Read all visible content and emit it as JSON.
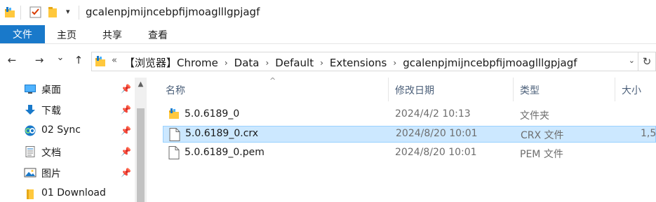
{
  "window": {
    "title": "gcalenpjmijncebpfijmoaglllgpjagf"
  },
  "ribbon": {
    "tabs": [
      {
        "label": "文件"
      },
      {
        "label": "主页"
      },
      {
        "label": "共享"
      },
      {
        "label": "查看"
      }
    ]
  },
  "nav": {
    "back_glyph": "←",
    "forward_glyph": "→",
    "recent_glyph": "⌄",
    "up_glyph": "↑",
    "overflow_glyph": "«",
    "breadcrumbs": [
      "【浏览器】Chrome",
      "Data",
      "Default",
      "Extensions",
      "gcalenpjmijncebpfijmoaglllgpjagf"
    ],
    "refresh_glyph": "↻"
  },
  "sidebar": {
    "items": [
      {
        "label": "桌面",
        "icon": "desktop-icon",
        "pinned": true
      },
      {
        "label": "下载",
        "icon": "download-icon",
        "pinned": true
      },
      {
        "label": "02 Sync",
        "icon": "sync-icon",
        "pinned": true
      },
      {
        "label": "文档",
        "icon": "document-icon",
        "pinned": true
      },
      {
        "label": "图片",
        "icon": "pictures-icon",
        "pinned": true
      },
      {
        "label": "01 Download",
        "icon": "folder-icon",
        "pinned": false
      }
    ]
  },
  "columns": {
    "name": "名称",
    "date": "修改日期",
    "type": "类型",
    "size": "大小"
  },
  "files": [
    {
      "name": "5.0.6189_0",
      "date": "2024/4/2 10:13",
      "type": "文件夹",
      "size": "",
      "icon": "folder-icon",
      "selected": false
    },
    {
      "name": "5.0.6189_0.crx",
      "date": "2024/8/20 10:01",
      "type": "CRX 文件",
      "size": "1,5",
      "icon": "file-icon",
      "selected": true
    },
    {
      "name": "5.0.6189_0.pem",
      "date": "2024/8/20 10:01",
      "type": "PEM 文件",
      "size": "",
      "icon": "file-icon",
      "selected": false
    }
  ],
  "colors": {
    "accent": "#1979ca",
    "selection_bg": "#cce8ff",
    "selection_border": "#99d1ff",
    "folder": "#ffc83d"
  }
}
